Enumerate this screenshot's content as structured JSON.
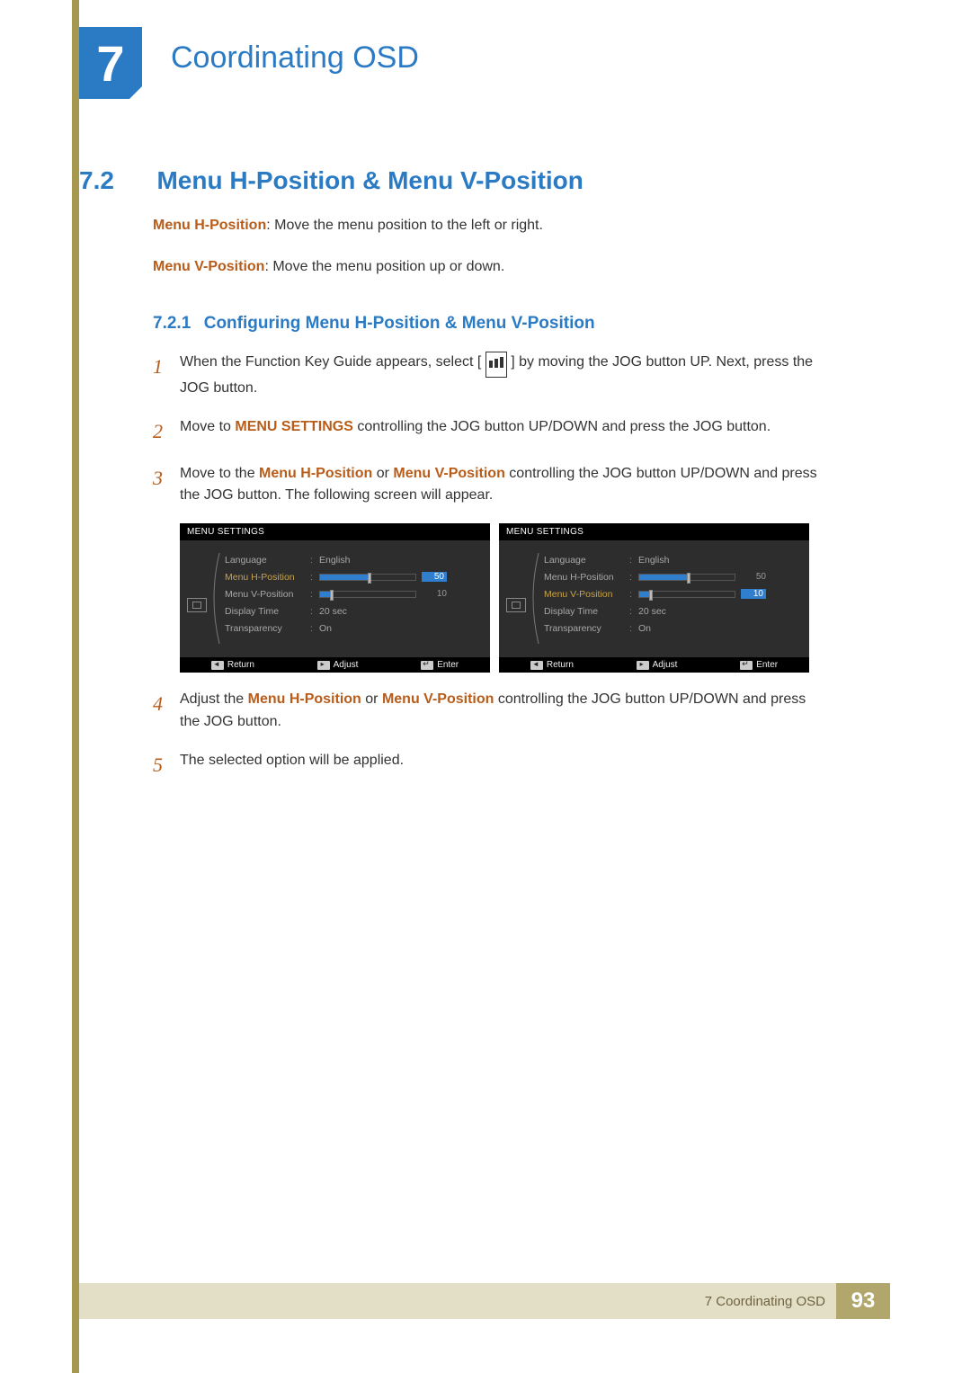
{
  "chapter": {
    "num": "7",
    "title": "Coordinating OSD"
  },
  "section": {
    "num": "7.2",
    "title": "Menu H-Position & Menu V-Position",
    "p1_label": "Menu H-Position",
    "p1_text": ": Move the menu position to the left or right.",
    "p2_label": "Menu V-Position",
    "p2_text": ": Move the menu position up or down."
  },
  "subsection": {
    "num": "7.2.1",
    "title": "Configuring Menu H-Position & Menu V-Position"
  },
  "steps": {
    "n1": "1",
    "s1a": "When the Function Key Guide appears, select [",
    "s1b": "] by moving the JOG button UP. Next, press the JOG button.",
    "n2": "2",
    "s2a": "Move to ",
    "s2em": "MENU SETTINGS",
    "s2b": " controlling the JOG button UP/DOWN and press the JOG button.",
    "n3": "3",
    "s3a": "Move to the ",
    "s3em1": "Menu H-Position",
    "s3or": " or ",
    "s3em2": "Menu V-Position",
    "s3b": " controlling the JOG button UP/DOWN and press the JOG button. The following screen will appear.",
    "n4": "4",
    "s4a": "Adjust the ",
    "s4em1": "Menu H-Position",
    "s4or": " or ",
    "s4em2": "Menu V-Position",
    "s4b": " controlling the JOG button UP/DOWN and press the JOG button.",
    "n5": "5",
    "s5": "The selected option will be applied."
  },
  "panel": {
    "header": "MENU SETTINGS",
    "rows": {
      "language": {
        "label": "Language",
        "value": "English"
      },
      "hpos": {
        "label": "Menu H-Position",
        "value": "50"
      },
      "vpos": {
        "label": "Menu V-Position",
        "value": "10"
      },
      "display": {
        "label": "Display Time",
        "value": "20 sec"
      },
      "trans": {
        "label": "Transparency",
        "value": "On"
      }
    },
    "footer": {
      "return": "Return",
      "adjust": "Adjust",
      "enter": "Enter"
    }
  },
  "footer": {
    "text": "7 Coordinating OSD",
    "page": "93"
  }
}
